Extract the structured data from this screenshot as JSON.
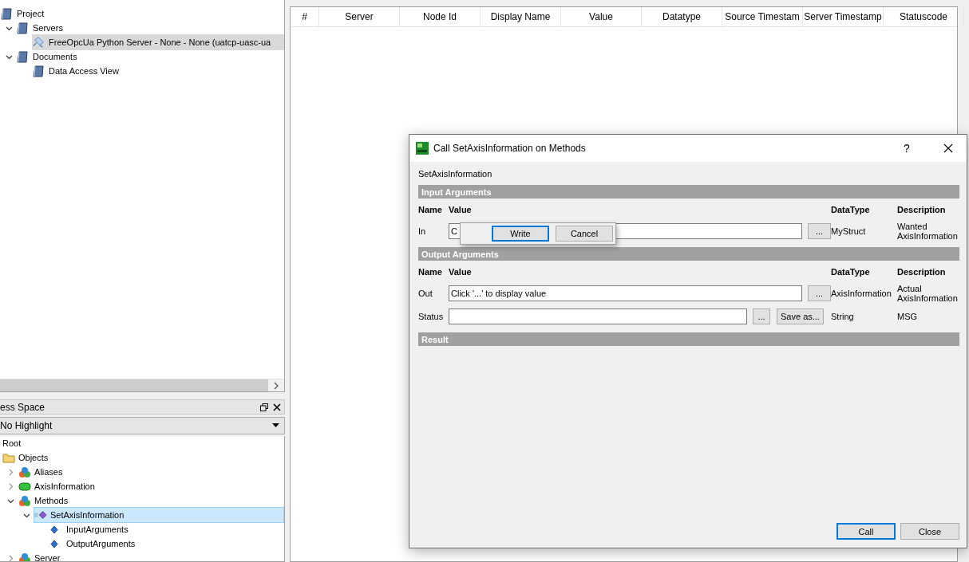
{
  "project_tree": {
    "items": [
      {
        "label": "Project",
        "kind": "book",
        "children": [
          {
            "label": "Servers",
            "kind": "book",
            "expanded": true,
            "children": [
              {
                "label": "FreeOpcUa Python Server - None - None (uatcp-uasc-ua",
                "kind": "server",
                "selected": true
              }
            ]
          },
          {
            "label": "Documents",
            "kind": "book",
            "expanded": true,
            "children": [
              {
                "label": "Data Access View",
                "kind": "book",
                "selected": false
              }
            ]
          }
        ]
      }
    ]
  },
  "dock": {
    "title": "ess Space"
  },
  "highlight_combo": {
    "value": "No Highlight"
  },
  "address_tree": {
    "items": [
      {
        "label": "Root",
        "children": [
          {
            "label": "Objects",
            "kind": "folder",
            "children": [
              {
                "label": "Aliases",
                "kind": "object",
                "expanded": false
              },
              {
                "label": "AxisInformation",
                "kind": "variable",
                "expanded": false
              },
              {
                "label": "Methods",
                "kind": "object",
                "expanded": true,
                "children": [
                  {
                    "label": "SetAxisInformation",
                    "kind": "method",
                    "expanded": true,
                    "selected": true,
                    "children": [
                      {
                        "label": "InputArguments",
                        "kind": "property",
                        "selected": false
                      },
                      {
                        "label": "OutputArguments",
                        "kind": "property",
                        "selected": false
                      }
                    ]
                  }
                ]
              },
              {
                "label": "Server",
                "kind": "object",
                "expanded": false
              }
            ]
          }
        ]
      }
    ]
  },
  "table": {
    "columns": [
      "#",
      "Server",
      "Node Id",
      "Display Name",
      "Value",
      "Datatype",
      "Source Timestam",
      "Server Timestamp",
      "Statuscode"
    ]
  },
  "dialog": {
    "title": "Call SetAxisInformation on Methods",
    "help": "?",
    "method_name": "SetAxisInformation",
    "sections": [
      {
        "title": "Input Arguments",
        "headers": [
          "Name",
          "Value",
          "DataType",
          "Description"
        ],
        "rows": [
          {
            "name": "In",
            "value": "C",
            "browse": "...",
            "datatype": "MyStruct",
            "description": "Wanted AxisInformation"
          }
        ]
      },
      {
        "title": "Output Arguments",
        "headers": [
          "Name",
          "Value",
          "DataType",
          "Description"
        ],
        "rows": [
          {
            "name": "Out",
            "value": "Click '...' to display value",
            "browse": "...",
            "datatype": "AxisInformation",
            "description": "Actual AxisInformation"
          },
          {
            "name": "Status",
            "browse": "...",
            "save": "Save as...",
            "datatype": "String",
            "description": "MSG"
          }
        ]
      },
      {
        "title": "Result"
      }
    ],
    "popup": {
      "buttons": [
        {
          "label": "Write",
          "focused": true
        },
        {
          "label": "Cancel",
          "focused": false
        }
      ]
    },
    "buttons": [
      {
        "label": "Call",
        "focused": true
      },
      {
        "label": "Close",
        "focused": false
      }
    ]
  }
}
